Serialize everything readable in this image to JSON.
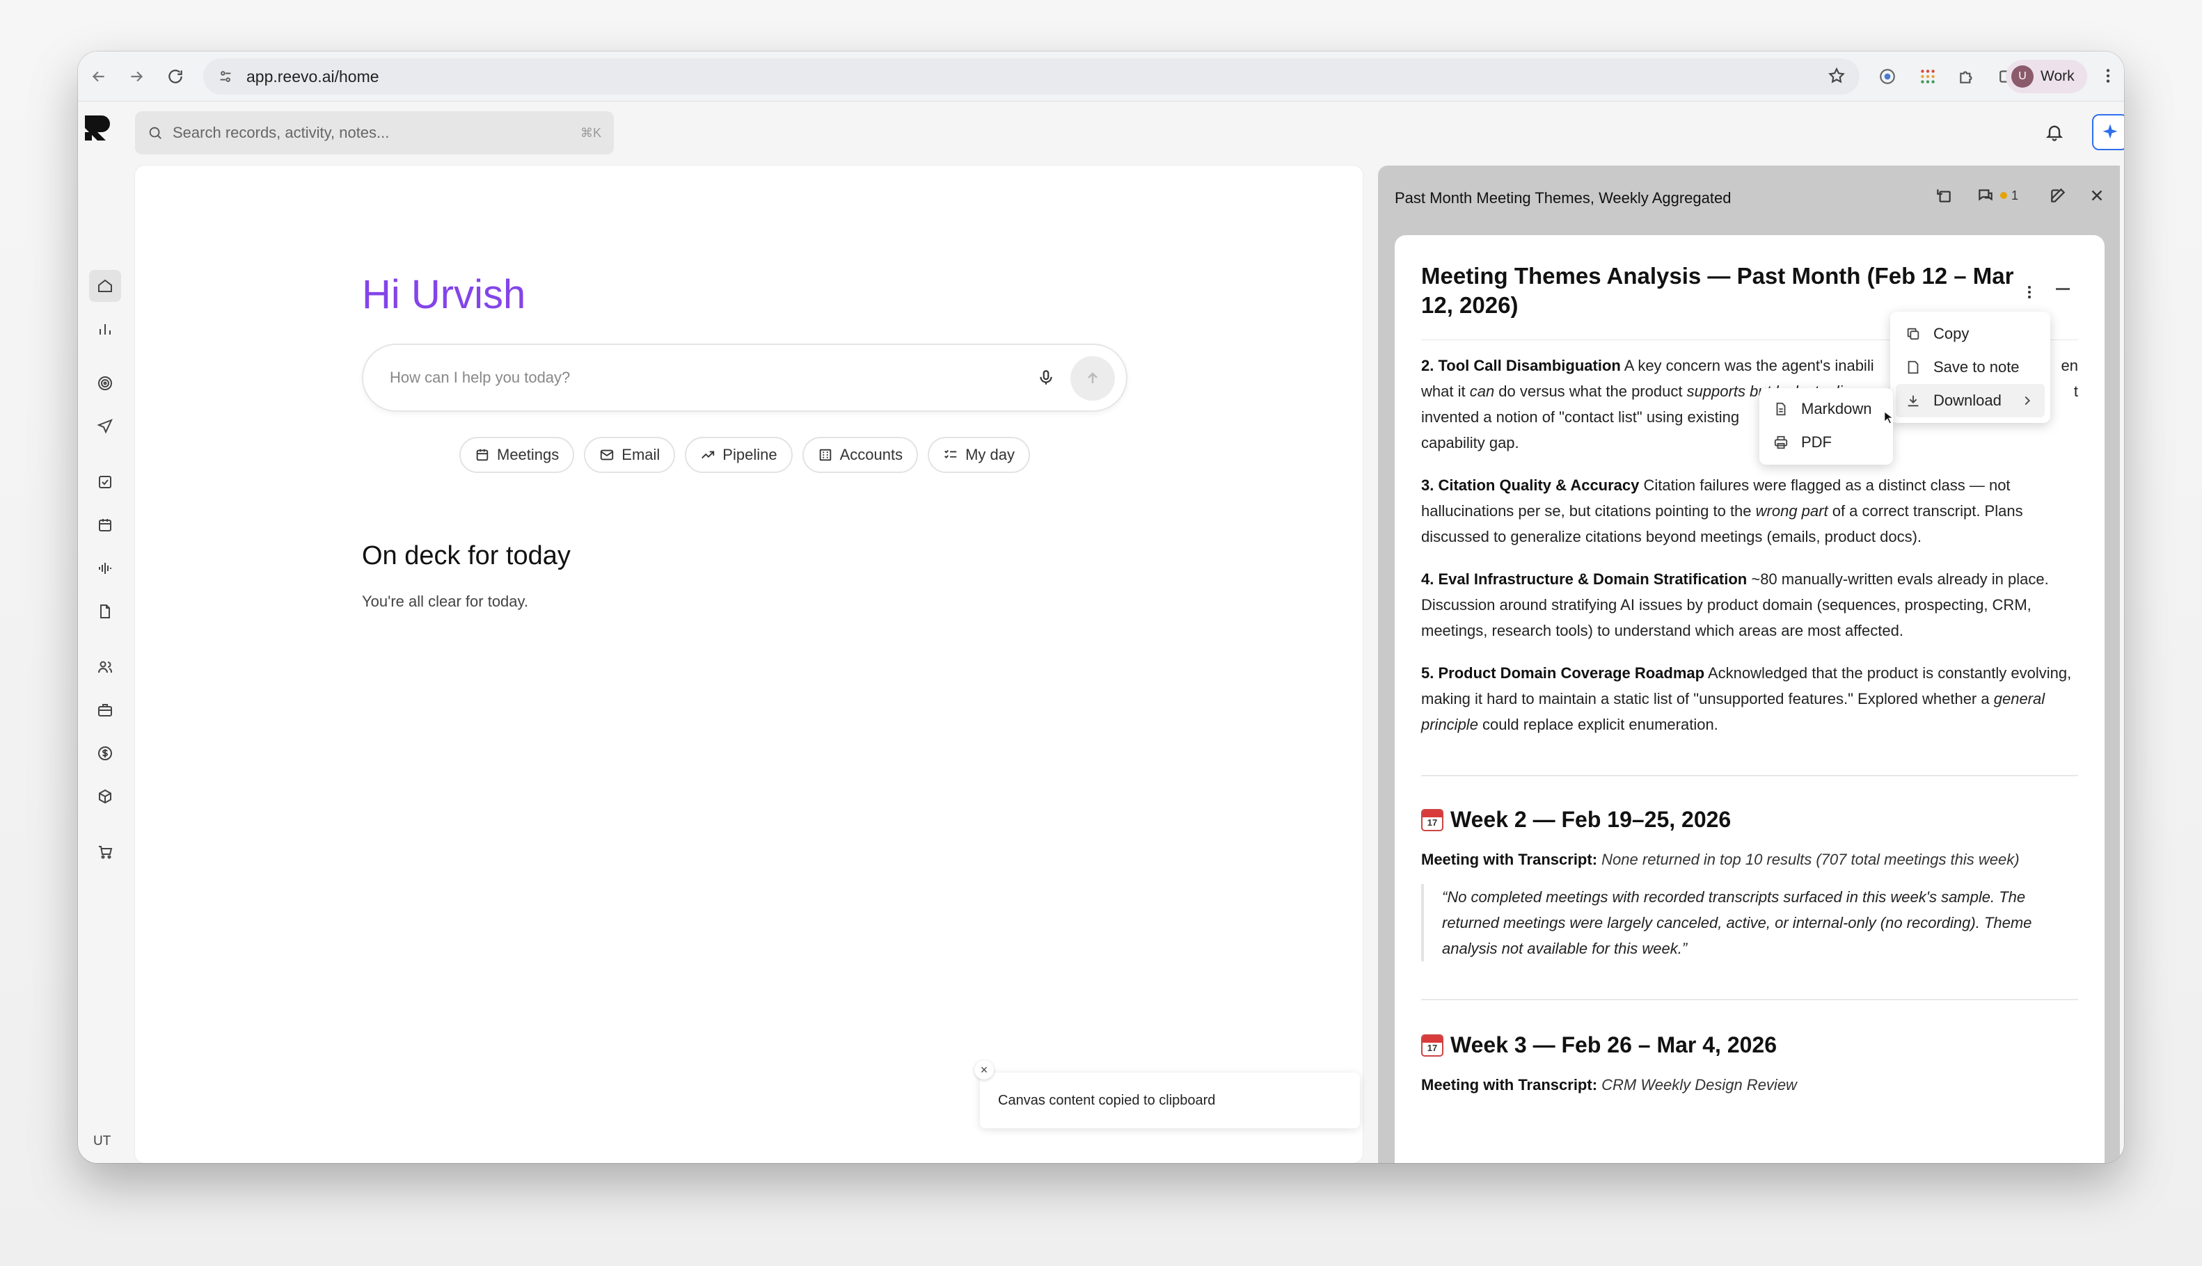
{
  "browser": {
    "url": "app.reevo.ai/home",
    "profile_initial": "U",
    "profile_label": "Work"
  },
  "app": {
    "search_placeholder": "Search records, activity, notes...",
    "search_shortcut": "⌘K",
    "user_initials": "UT"
  },
  "main": {
    "greeting": "Hi Urvish",
    "ask_placeholder": "How can I help you today?",
    "chips": [
      "Meetings",
      "Email",
      "Pipeline",
      "Accounts",
      "My day"
    ],
    "deck_title": "On deck for today",
    "deck_empty": "You're all clear for today."
  },
  "toast": {
    "text": "Canvas content copied to clipboard",
    "close": "×"
  },
  "panel": {
    "title": "Past Month Meeting Themes, Weekly Aggregated",
    "comment_count": "1",
    "doc": {
      "heading": "Meeting Themes Analysis — Past Month (Feb 12 – Mar 12, 2026)",
      "item2_title": "2. Tool Call Disambiguation",
      "item2_a": " A key concern was the agent's inabili",
      "item2_b": "en",
      "item2_c": "what it ",
      "item2_can": "can",
      "item2_d": " do versus what the product ",
      "item2_supports": "supports but lacks tooling",
      "item2_e": "t",
      "item2_f": "invented a notion of \"contact list\" using existing",
      "item2_g": "capability gap.",
      "item3_title": "3. Citation Quality & Accuracy",
      "item3_a": " Citation failures were flagged as a distinct class — not hallucinations per se, but citations pointing to the ",
      "item3_wrong": "wrong part",
      "item3_b": " of a correct transcript. Plans discussed to generalize citations beyond meetings (emails, product docs).",
      "item4_title": "4. Eval Infrastructure & Domain Stratification",
      "item4_a": " ~80 manually-written evals already in place. Discussion around stratifying AI issues by product domain (sequences, prospecting, CRM, meetings, research tools) to understand which areas are most affected.",
      "item5_title": "5. Product Domain Coverage Roadmap",
      "item5_a": " Acknowledged that the product is constantly evolving, making it hard to maintain a static list of \"unsupported features.\" Explored whether a ",
      "item5_gp": "general principle",
      "item5_b": " could replace explicit enumeration.",
      "cal_day": "17",
      "week2_title": "Week 2 — Feb 19–25, 2026",
      "week2_label": "Meeting with Transcript:",
      "week2_value": "None returned in top 10 results (707 total meetings this week)",
      "week2_quote": "“No completed meetings with recorded transcripts surfaced in this week's sample. The returned meetings were largely canceled, active, or internal-only (no recording). Theme analysis not available for this week.”",
      "week3_title": "Week 3 — Feb 26 – Mar 4, 2026",
      "week3_label": "Meeting with Transcript:",
      "week3_value": "CRM Weekly Design Review"
    }
  },
  "context_menu": {
    "items": [
      "Copy",
      "Save to note",
      "Download"
    ],
    "download_submenu": [
      "Markdown",
      "PDF"
    ]
  }
}
